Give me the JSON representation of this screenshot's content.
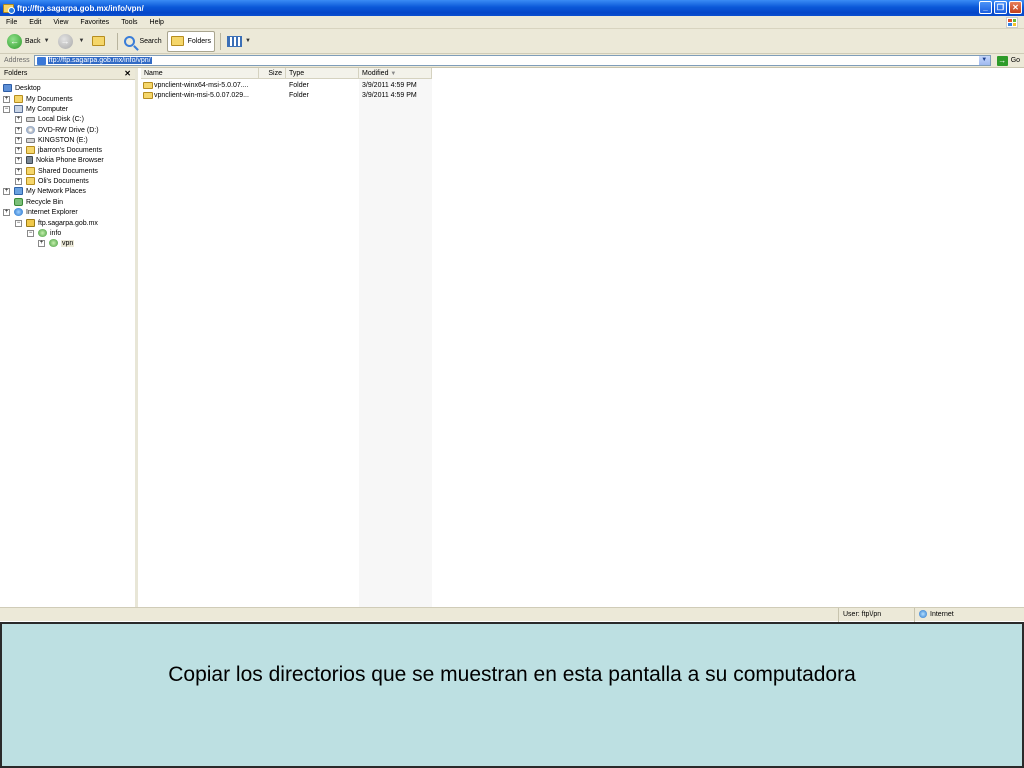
{
  "window": {
    "title": "ftp://ftp.sagarpa.gob.mx/info/vpn/"
  },
  "menu": [
    "File",
    "Edit",
    "View",
    "Favorites",
    "Tools",
    "Help"
  ],
  "toolbar": {
    "back": "Back",
    "search": "Search",
    "folders": "Folders"
  },
  "address": {
    "label": "Address",
    "url": "ftp://ftp.sagarpa.gob.mx/info/vpn/",
    "go": "Go"
  },
  "folders_pane": {
    "title": "Folders",
    "tree": [
      {
        "label": "Desktop",
        "icon": "desktop-icon"
      },
      {
        "label": "My Documents",
        "icon": "folder-icon",
        "toggle": "+"
      },
      {
        "label": "My Computer",
        "icon": "computer-icon",
        "toggle": "−"
      },
      {
        "label": "Local Disk (C:)",
        "icon": "disk-icon",
        "toggle": "+"
      },
      {
        "label": "DVD-RW Drive (D:)",
        "icon": "cd-icon",
        "toggle": "+"
      },
      {
        "label": "KINGSTON (E:)",
        "icon": "disk-icon",
        "toggle": "+"
      },
      {
        "label": "jbarron's Documents",
        "icon": "folder-icon",
        "toggle": "+"
      },
      {
        "label": "Nokia Phone Browser",
        "icon": "phone-icon",
        "toggle": "+"
      },
      {
        "label": "Shared Documents",
        "icon": "folder-icon",
        "toggle": "+"
      },
      {
        "label": "Oli's Documents",
        "icon": "folder-icon",
        "toggle": "+"
      },
      {
        "label": "My Network Places",
        "icon": "network-icon",
        "toggle": "+"
      },
      {
        "label": "Recycle Bin",
        "icon": "recycle-bin-icon"
      },
      {
        "label": "Internet Explorer",
        "icon": "ie-icon",
        "toggle": "+"
      },
      {
        "label": "ftp.sagarpa.gob.mx",
        "icon": "ftp-server-icon",
        "toggle": "−"
      },
      {
        "label": "info",
        "icon": "ftp-folder-icon",
        "toggle": "−"
      },
      {
        "label": "vpn",
        "icon": "ftp-folder-icon",
        "toggle": "+"
      }
    ]
  },
  "filelist": {
    "columns": {
      "name": "Name",
      "size": "Size",
      "type": "Type",
      "modified": "Modified"
    },
    "rows": [
      {
        "name": "vpnclient-winx64-msi-5.0.07....",
        "size": "",
        "type": "Folder",
        "modified": "3/9/2011 4:59 PM"
      },
      {
        "name": "vpnclient-win-msi-5.0.07.029...",
        "size": "",
        "type": "Folder",
        "modified": "3/9/2011 4:59 PM"
      }
    ]
  },
  "status": {
    "user": "User: ftp\\/pn",
    "zone": "Internet"
  },
  "caption": "Copiar los directorios que se muestran en esta pantalla a su computadora",
  "colors": {
    "title_bar": "#0a58d8",
    "chrome": "#ece9d8",
    "selection": "#316ac5",
    "caption_bg": "#bde0e2"
  }
}
